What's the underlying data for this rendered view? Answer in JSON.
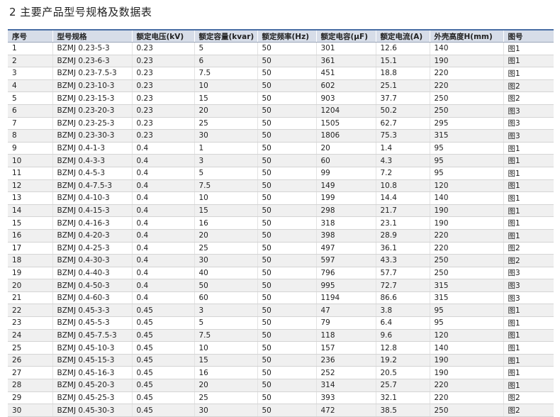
{
  "title": "2 主要产品型号规格及数据表",
  "columns": [
    "序号",
    "型号规格",
    "额定电压(kV)",
    "额定容量(kvar)",
    "额定频率(Hz)",
    "额定电容(μF)",
    "额定电流(A)",
    "外壳高度H(mm)",
    "图号"
  ],
  "rows": [
    [
      "1",
      "BZMJ 0.23-5-3",
      "0.23",
      "5",
      "50",
      "301",
      "12.6",
      "140",
      "图1"
    ],
    [
      "2",
      "BZMJ 0.23-6-3",
      "0.23",
      "6",
      "50",
      "361",
      "15.1",
      "190",
      "图1"
    ],
    [
      "3",
      "BZMJ 0.23-7.5-3",
      "0.23",
      "7.5",
      "50",
      "451",
      "18.8",
      "220",
      "图1"
    ],
    [
      "4",
      "BZMJ 0.23-10-3",
      "0.23",
      "10",
      "50",
      "602",
      "25.1",
      "220",
      "图2"
    ],
    [
      "5",
      "BZMJ 0.23-15-3",
      "0.23",
      "15",
      "50",
      "903",
      "37.7",
      "250",
      "图2"
    ],
    [
      "6",
      "BZMJ 0.23-20-3",
      "0.23",
      "20",
      "50",
      "1204",
      "50.2",
      "250",
      "图3"
    ],
    [
      "7",
      "BZMJ 0.23-25-3",
      "0.23",
      "25",
      "50",
      "1505",
      "62.7",
      "295",
      "图3"
    ],
    [
      "8",
      "BZMJ 0.23-30-3",
      "0.23",
      "30",
      "50",
      "1806",
      "75.3",
      "315",
      "图3"
    ],
    [
      "9",
      "BZMJ 0.4-1-3",
      "0.4",
      "1",
      "50",
      "20",
      "1.4",
      "95",
      "图1"
    ],
    [
      "10",
      "BZMJ 0.4-3-3",
      "0.4",
      "3",
      "50",
      "60",
      "4.3",
      "95",
      "图1"
    ],
    [
      "11",
      "BZMJ 0.4-5-3",
      "0.4",
      "5",
      "50",
      "99",
      "7.2",
      "95",
      "图1"
    ],
    [
      "12",
      "BZMJ 0.4-7.5-3",
      "0.4",
      "7.5",
      "50",
      "149",
      "10.8",
      "120",
      "图1"
    ],
    [
      "13",
      "BZMJ 0.4-10-3",
      "0.4",
      "10",
      "50",
      "199",
      "14.4",
      "140",
      "图1"
    ],
    [
      "14",
      "BZMJ 0.4-15-3",
      "0.4",
      "15",
      "50",
      "298",
      "21.7",
      "190",
      "图1"
    ],
    [
      "15",
      "BZMJ 0.4-16-3",
      "0.4",
      "16",
      "50",
      "318",
      "23.1",
      "190",
      "图1"
    ],
    [
      "16",
      "BZMJ 0.4-20-3",
      "0.4",
      "20",
      "50",
      "398",
      "28.9",
      "220",
      "图1"
    ],
    [
      "17",
      "BZMJ 0.4-25-3",
      "0.4",
      "25",
      "50",
      "497",
      "36.1",
      "220",
      "图2"
    ],
    [
      "18",
      "BZMJ 0.4-30-3",
      "0.4",
      "30",
      "50",
      "597",
      "43.3",
      "250",
      "图2"
    ],
    [
      "19",
      "BZMJ 0.4-40-3",
      "0.4",
      "40",
      "50",
      "796",
      "57.7",
      "250",
      "图3"
    ],
    [
      "20",
      "BZMJ 0.4-50-3",
      "0.4",
      "50",
      "50",
      "995",
      "72.7",
      "315",
      "图3"
    ],
    [
      "21",
      "BZMJ 0.4-60-3",
      "0.4",
      "60",
      "50",
      "1194",
      "86.6",
      "315",
      "图3"
    ],
    [
      "22",
      "BZMJ 0.45-3-3",
      "0.45",
      "3",
      "50",
      "47",
      "3.8",
      "95",
      "图1"
    ],
    [
      "23",
      "BZMJ 0.45-5-3",
      "0.45",
      "5",
      "50",
      "79",
      "6.4",
      "95",
      "图1"
    ],
    [
      "24",
      "BZMJ 0.45-7.5-3",
      "0.45",
      "7.5",
      "50",
      "118",
      "9.6",
      "120",
      "图1"
    ],
    [
      "25",
      "BZMJ 0.45-10-3",
      "0.45",
      "10",
      "50",
      "157",
      "12.8",
      "140",
      "图1"
    ],
    [
      "26",
      "BZMJ 0.45-15-3",
      "0.45",
      "15",
      "50",
      "236",
      "19.2",
      "190",
      "图1"
    ],
    [
      "27",
      "BZMJ 0.45-16-3",
      "0.45",
      "16",
      "50",
      "252",
      "20.5",
      "190",
      "图1"
    ],
    [
      "28",
      "BZMJ 0.45-20-3",
      "0.45",
      "20",
      "50",
      "314",
      "25.7",
      "220",
      "图1"
    ],
    [
      "29",
      "BZMJ 0.45-25-3",
      "0.45",
      "25",
      "50",
      "393",
      "32.1",
      "220",
      "图2"
    ],
    [
      "30",
      "BZMJ 0.45-30-3",
      "0.45",
      "30",
      "50",
      "472",
      "38.5",
      "250",
      "图2"
    ]
  ]
}
